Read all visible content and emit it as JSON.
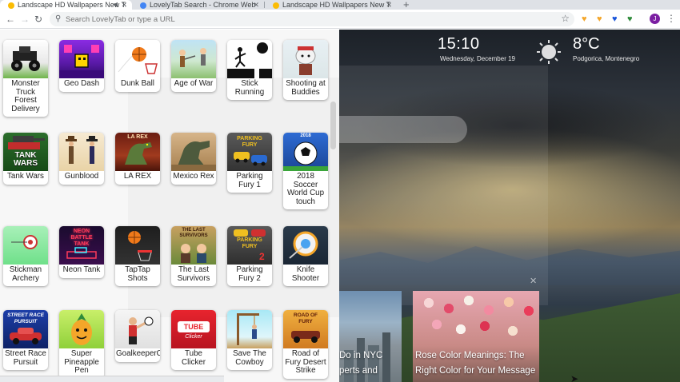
{
  "browser": {
    "tabs": [
      {
        "title": "Landscape HD Wallpapers New Tab",
        "active": true
      },
      {
        "title": "LovelyTab Search - Chrome Web Store",
        "active": false
      },
      {
        "title": "Landscape HD Wallpapers New Tab",
        "active": false
      }
    ],
    "omnibox_placeholder": "Search LovelyTab or type a URL",
    "profile_initial": "J",
    "extension_colors": [
      "#f4a62a",
      "#f4a62a",
      "#1a56db",
      "#2e8b3a"
    ]
  },
  "games": [
    {
      "label": "Monster\nTruck\nForest\nDelivery",
      "icon": "monster-truck-icon"
    },
    {
      "label": "Geo Dash",
      "icon": "geo-dash-icon"
    },
    {
      "label": "Dunk Ball",
      "icon": "basketball-icon"
    },
    {
      "label": "Age of War",
      "icon": "soldiers-icon"
    },
    {
      "label": "Stick\nRunning",
      "icon": "stickman-icon"
    },
    {
      "label": "Shooting at\nBuddies",
      "icon": "buddy-icon"
    },
    {
      "label": "Tank Wars",
      "icon": "tank-icon"
    },
    {
      "label": "Gunblood",
      "icon": "cowboy-icon"
    },
    {
      "label": "LA REX",
      "icon": "dinosaur-icon"
    },
    {
      "label": "Mexico Rex",
      "icon": "dinosaur-icon"
    },
    {
      "label": "Parking\nFury 1",
      "icon": "car-icon"
    },
    {
      "label": "2018\nSoccer\nWorld Cup\ntouch",
      "icon": "soccer-ball-icon"
    },
    {
      "label": "Stickman\nArchery",
      "icon": "target-icon"
    },
    {
      "label": "Neon Tank",
      "icon": "neon-tank-icon"
    },
    {
      "label": "TapTap\nShots",
      "icon": "basketball-icon"
    },
    {
      "label": "The Last\nSurvivors",
      "icon": "survivors-icon"
    },
    {
      "label": "Parking\nFury 2",
      "icon": "car-icon"
    },
    {
      "label": "Knife\nShooter",
      "icon": "knife-target-icon"
    },
    {
      "label": "Street Race\nPursuit",
      "icon": "race-car-icon"
    },
    {
      "label": "Super\nPineapple\nPen",
      "icon": "pineapple-icon"
    },
    {
      "label": "GoalkeeperChallenge",
      "icon": "goalkeeper-icon"
    },
    {
      "label": "Tube Clicker",
      "icon": "tube-icon"
    },
    {
      "label": "Save The\nCowboy",
      "icon": "rope-icon"
    },
    {
      "label": "Road of\nFury Desert\nStrike",
      "icon": "desert-car-icon"
    }
  ],
  "thumb_text": {
    "tank": "TANK\nWARS",
    "larex": "LA REX",
    "neon": "NEON\nBATTLE\nTANK",
    "parking": "PARKING\nFURY",
    "soccer": "2018",
    "survivors": "THE LAST\nSURVIVORS",
    "street": "STREET RACE\nPURSUIT",
    "tube": "TUBE",
    "tube_sub": "Clicker",
    "road": "ROAD OF\nFURY"
  },
  "widgets": {
    "time": "15:10",
    "date": "Wednesday, December 19",
    "temperature": "8°C",
    "location": "Podgorica, Montenegro"
  },
  "news": [
    {
      "text": "Do in NYC\nperts and"
    },
    {
      "text": "Rose Color Meanings: The\nRight Color for Your Message"
    }
  ],
  "status_text": " "
}
